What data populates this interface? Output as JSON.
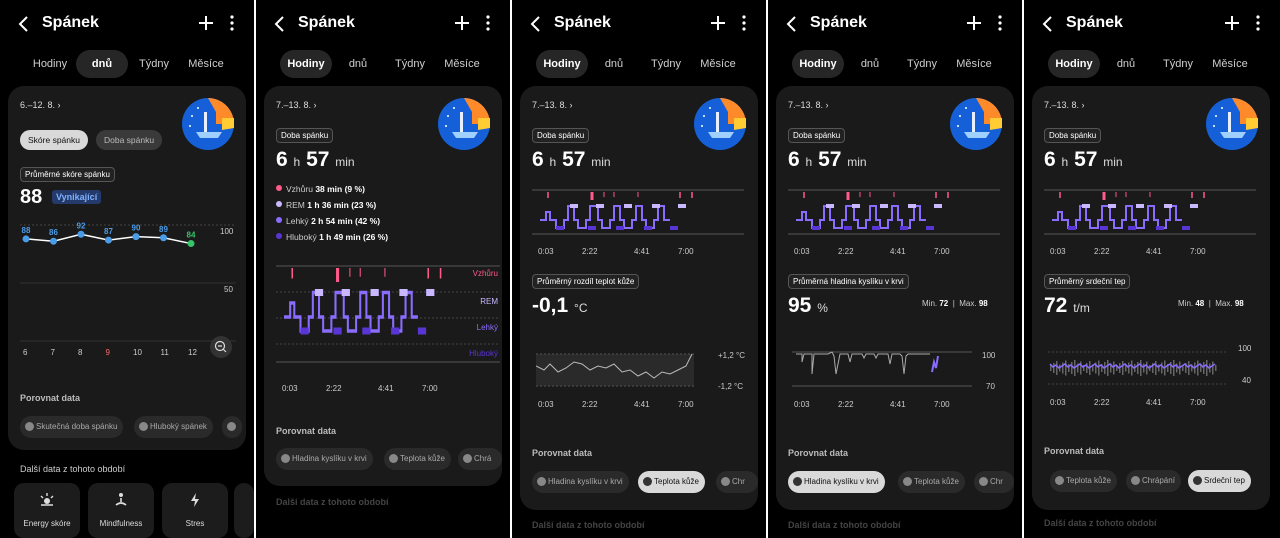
{
  "app_title": "Spánek",
  "tabs": [
    "Hodiny",
    "dnů",
    "Týdny",
    "Měsíce"
  ],
  "compare_label": "Porovnat data",
  "more_data_label": "Další data z tohoto období",
  "axis_times": [
    "0:03",
    "2:22",
    "4:41",
    "7:00"
  ],
  "duration": {
    "h": "6",
    "h_unit": "h",
    "m": "57",
    "m_unit": "min"
  },
  "s1": {
    "date": "6.–12. 8.",
    "toggle": [
      "Skóre spánku",
      "Doba spánku"
    ],
    "avg_label": "Průměrné skóre spánku",
    "avg_value": "88",
    "avg_badge": "Vynikající",
    "chart_data": {
      "type": "line",
      "categories": [
        "6",
        "7",
        "8",
        "9",
        "10",
        "11",
        "12"
      ],
      "values": [
        88,
        86,
        92,
        87,
        90,
        89,
        84
      ],
      "ylabels": [
        "100",
        "50"
      ],
      "highlight_day": "9"
    },
    "chips": [
      "Skutečná doba spánku",
      "Hluboký spánek"
    ],
    "tiles": [
      "Energy skóre",
      "Mindfulness",
      "Stres"
    ]
  },
  "s2": {
    "date": "7.–13. 8.",
    "pill": "Doba spánku",
    "legend": [
      {
        "name": "Vzhůru",
        "value": "38 min (9 %)",
        "color": "#ff5a8a"
      },
      {
        "name": "REM",
        "value": "1 h 36 min (23 %)",
        "color": "#c9b8ff"
      },
      {
        "name": "Lehký",
        "value": "2 h 54 min (42 %)",
        "color": "#8a6cff"
      },
      {
        "name": "Hluboký",
        "value": "1 h 49 min (26 %)",
        "color": "#5a35d6"
      }
    ],
    "stage_labels": [
      "Vzhůru",
      "REM",
      "Lehký",
      "Hluboký"
    ],
    "chips": [
      "Hladina kyslíku v krvi",
      "Teplota kůže",
      "Chrá"
    ]
  },
  "s3": {
    "date": "7.–13. 8.",
    "pill": "Doba spánku",
    "metric_label": "Průměrný rozdíl teplot kůže",
    "metric_value": "-0,1",
    "metric_unit": "°C",
    "yhigh": "+1,2 °C",
    "ylow": "-1,2 °C",
    "chips": [
      "Hladina kyslíku v krvi",
      "Teplota kůže",
      "Chr"
    ]
  },
  "s4": {
    "date": "7.–13. 8.",
    "pill": "Doba spánku",
    "metric_label": "Průměrná hladina kyslíku v krvi",
    "metric_value": "95",
    "metric_unit": "%",
    "min_label": "Min.",
    "min_value": "72",
    "max_label": "Max.",
    "max_value": "98",
    "yhigh": "100",
    "ylow": "70",
    "chips": [
      "Hladina kyslíku v krvi",
      "Teplota kůže",
      "Chr"
    ]
  },
  "s5": {
    "date": "7.–13. 8.",
    "pill": "Doba spánku",
    "metric_label": "Průměrný srdeční tep",
    "metric_value": "72",
    "metric_unit": "t/m",
    "min_label": "Min.",
    "min_value": "48",
    "max_label": "Max.",
    "max_value": "98",
    "yhigh": "100",
    "ylow": "40",
    "chips": [
      "Teplota kůže",
      "Chrápání",
      "Srdeční tep"
    ]
  },
  "colors": {
    "accent": "#7b5cff",
    "awake": "#ff5a8a",
    "score_blue": "#4a9ce8",
    "score_green": "#35c46a",
    "low_day": "#ff6b6b"
  }
}
